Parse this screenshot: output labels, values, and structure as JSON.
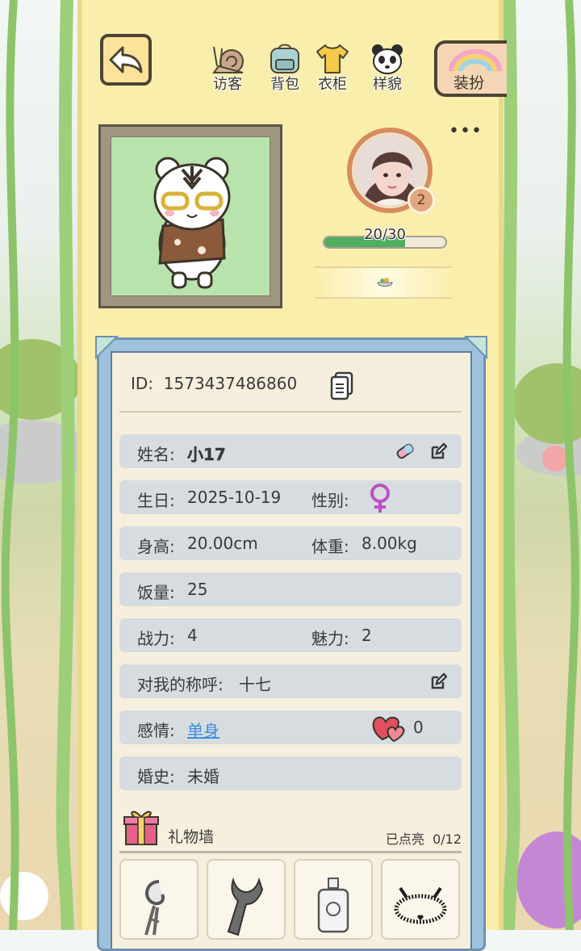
{
  "nav": {
    "visitors_label": "访客",
    "backpack_label": "背包",
    "wardrobe_label": "衣柜",
    "appearance_label": "样貌",
    "dress_up_label": "装扮"
  },
  "avatar": {
    "level": "2"
  },
  "stamina": {
    "text": "20/30",
    "fraction": 0.667
  },
  "profile": {
    "id_label": "ID:",
    "id_value": "1573437486860",
    "name_label": "姓名:",
    "name_value": "小17",
    "birthday_label": "生日:",
    "birthday_value": "2025-10-19",
    "gender_label": "性别:",
    "gender_icon": "female-icon",
    "height_label": "身高:",
    "height_value": "20.00cm",
    "weight_label": "体重:",
    "weight_value": "8.00kg",
    "appetite_label": "饭量:",
    "appetite_value": "25",
    "combat_label": "战力:",
    "combat_value": "4",
    "charm_label": "魅力:",
    "charm_value": "2",
    "nickname_label": "对我的称呼:",
    "nickname_value": "十七",
    "relationship_label": "感情:",
    "relationship_value": "单身",
    "hearts_count": "0",
    "marriage_label": "婚史:",
    "marriage_value": "未婚"
  },
  "gift_wall": {
    "title": "礼物墙",
    "lit_label": "已点亮",
    "lit_count": "0/12",
    "items": [
      "bouquet-icon",
      "scarf-icon",
      "perfume-icon",
      "bracelet-icon"
    ]
  },
  "colors": {
    "panel": "#faeeac",
    "card_border": "#9ec2dd",
    "row_bg": "#d6dce0",
    "link": "#3a8de0",
    "hp_fill": "#4eae5e",
    "female": "#c04fc3",
    "heart": "#e0515d"
  }
}
